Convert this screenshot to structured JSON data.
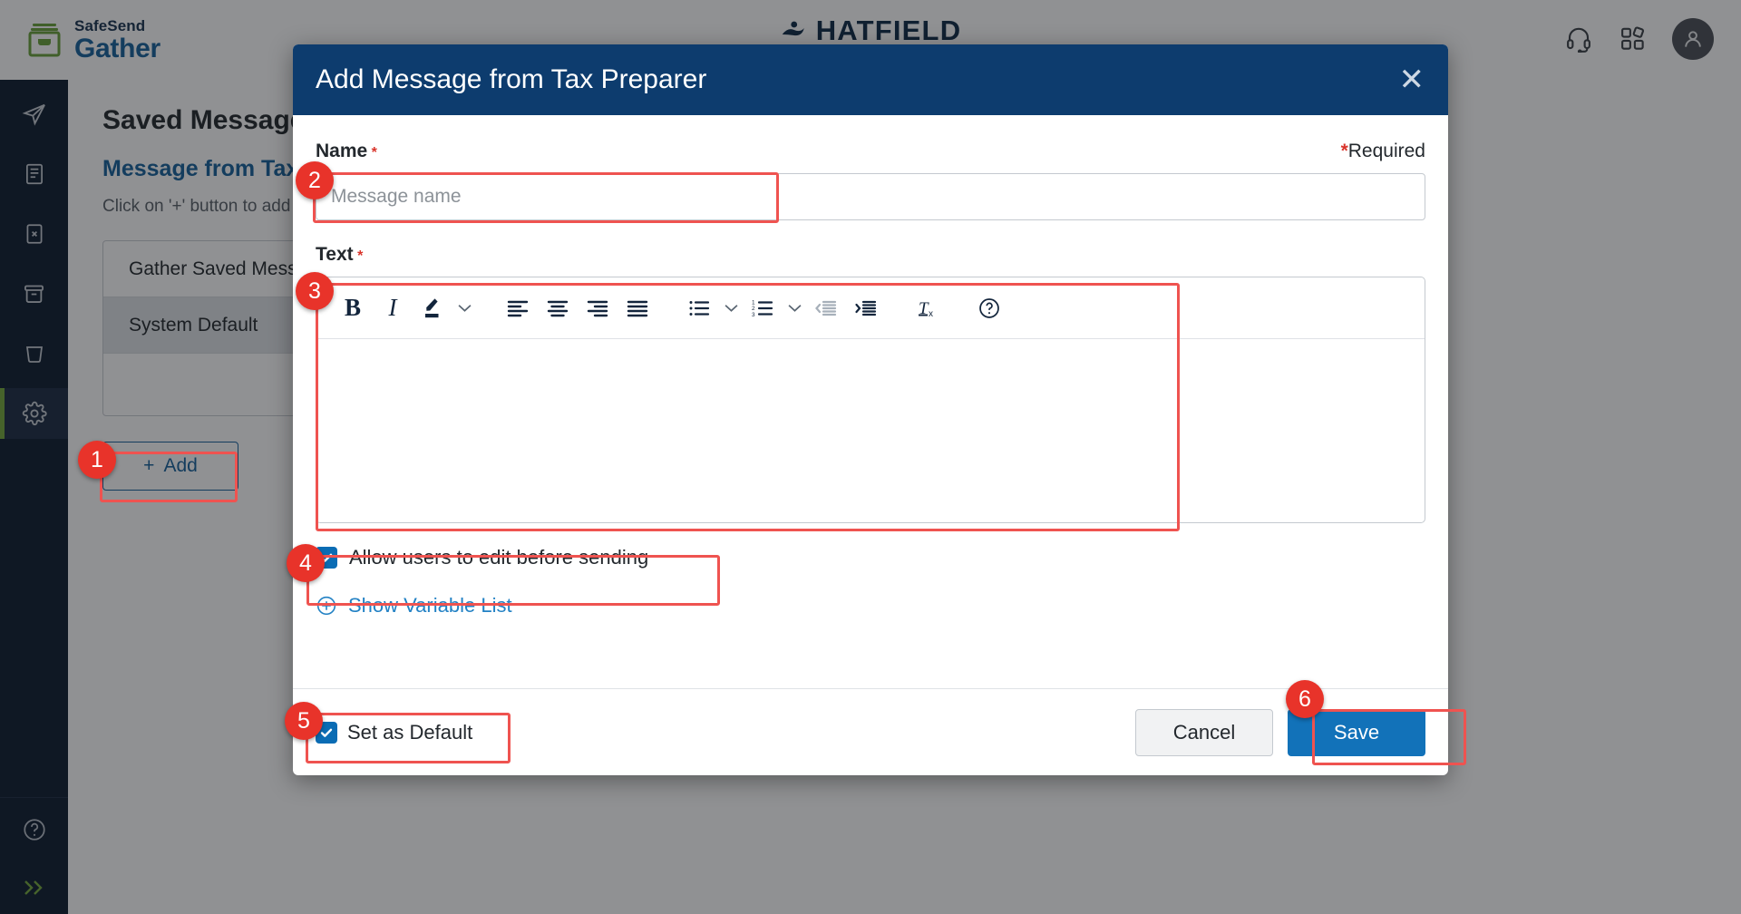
{
  "brand": {
    "top": "SafeSend",
    "bottom": "Gather",
    "icon": "gather-box-icon"
  },
  "firm": {
    "name": "HATFIELD",
    "icon": "hatfield-mark-icon"
  },
  "topbar": {
    "support_icon": "headset-icon",
    "apps_icon": "apps-grid-icon",
    "avatar_icon": "user-avatar-icon"
  },
  "sidebar": {
    "items": [
      {
        "name": "sidebar-item-send",
        "icon": "paper-plane-icon",
        "active": false
      },
      {
        "name": "sidebar-item-documents",
        "icon": "document-icon",
        "active": false
      },
      {
        "name": "sidebar-item-cancelled",
        "icon": "x-box-icon",
        "active": false
      },
      {
        "name": "sidebar-item-archive",
        "icon": "archive-icon",
        "active": false
      },
      {
        "name": "sidebar-item-recycle",
        "icon": "trash-icon",
        "active": false
      },
      {
        "name": "sidebar-item-settings",
        "icon": "gear-icon",
        "active": true
      }
    ],
    "help_icon": "help-circle-icon",
    "expand_icon": "double-chevron-right-icon"
  },
  "page": {
    "title": "Saved Messages",
    "section_title": "Message from Tax Preparer",
    "description": "Click on '+' button to add message",
    "table_rows": [
      {
        "label": "Gather Saved Messages",
        "selected": false
      },
      {
        "label": "System Default",
        "selected": true
      },
      {
        "label": "",
        "selected": false
      }
    ],
    "add_button": "Add",
    "add_icon": "plus-icon"
  },
  "modal": {
    "title": "Add Message from Tax Preparer",
    "close_icon": "close-icon",
    "required_note": "Required",
    "required_star": "*",
    "name": {
      "label": "Name",
      "placeholder": "Message name",
      "value": ""
    },
    "text": {
      "label": "Text",
      "value": ""
    },
    "toolbar": [
      {
        "name": "bold-button",
        "icon": "bold-icon",
        "label": "B",
        "dim": false
      },
      {
        "name": "italic-button",
        "icon": "italic-icon",
        "label": "I",
        "dim": false
      },
      {
        "name": "highlight-color-button",
        "icon": "highlighter-pen-icon",
        "label": "",
        "dim": false
      },
      {
        "name": "highlight-color-dropdown",
        "icon": "chevron-down-icon",
        "label": "",
        "dim": false
      },
      {
        "name": "align-left-button",
        "icon": "align-left-icon",
        "label": "",
        "dim": false
      },
      {
        "name": "align-center-button",
        "icon": "align-center-icon",
        "label": "",
        "dim": false
      },
      {
        "name": "align-right-button",
        "icon": "align-right-icon",
        "label": "",
        "dim": false
      },
      {
        "name": "align-justify-button",
        "icon": "align-justify-icon",
        "label": "",
        "dim": false
      },
      {
        "name": "bullet-list-button",
        "icon": "bullet-list-icon",
        "label": "",
        "dim": false
      },
      {
        "name": "bullet-list-dropdown",
        "icon": "chevron-down-icon",
        "label": "",
        "dim": false
      },
      {
        "name": "numbered-list-button",
        "icon": "numbered-list-icon",
        "label": "",
        "dim": false
      },
      {
        "name": "numbered-list-dropdown",
        "icon": "chevron-down-icon",
        "label": "",
        "dim": false
      },
      {
        "name": "outdent-button",
        "icon": "outdent-icon",
        "label": "",
        "dim": true
      },
      {
        "name": "indent-button",
        "icon": "indent-icon",
        "label": "",
        "dim": false
      },
      {
        "name": "clear-formatting-button",
        "icon": "clear-format-icon",
        "label": "",
        "dim": false
      },
      {
        "name": "editor-help-button",
        "icon": "help-circle-icon",
        "label": "",
        "dim": false
      }
    ],
    "allow_edit": {
      "label": "Allow users to edit before sending",
      "checked": true
    },
    "show_variable_list": {
      "label": "Show Variable List",
      "icon": "plus-circle-icon"
    },
    "set_as_default": {
      "label": "Set as Default",
      "checked": true
    },
    "cancel_label": "Cancel",
    "save_label": "Save"
  },
  "annotations": [
    {
      "number": "1",
      "target": "add-button"
    },
    {
      "number": "2",
      "target": "name-input"
    },
    {
      "number": "3",
      "target": "text-editor"
    },
    {
      "number": "4",
      "target": "allow-edit-checkbox-row"
    },
    {
      "number": "5",
      "target": "set-as-default-checkbox-row"
    },
    {
      "number": "6",
      "target": "save-button"
    }
  ],
  "colors": {
    "modal_header": "#0d3c6e",
    "save_button": "#1272b9",
    "accent_link": "#2281c4",
    "sidebar": "#0d1b2e",
    "active_marker": "#74a83c",
    "annotation": "#e8332a",
    "required": "#d9342b"
  }
}
